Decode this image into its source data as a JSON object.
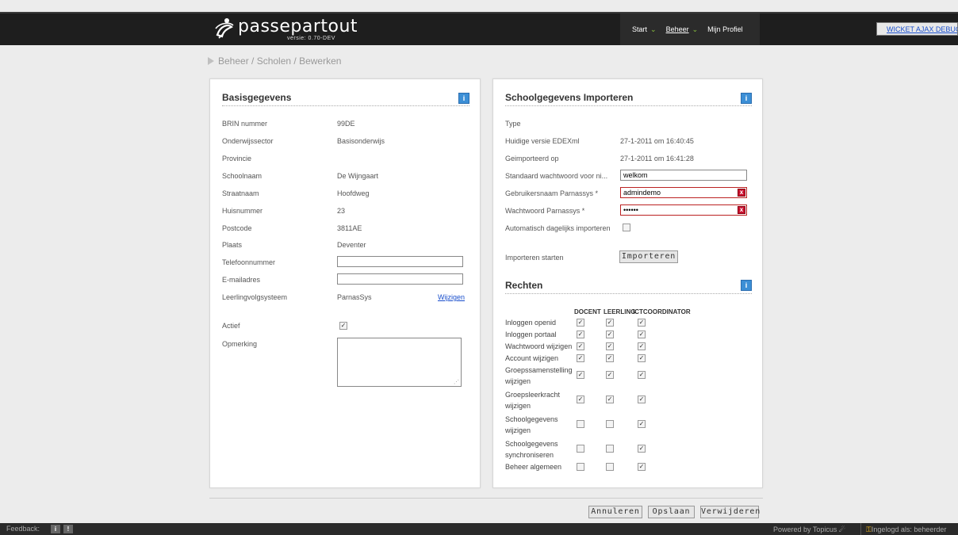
{
  "header": {
    "logo_text": "passepartout",
    "version": "versie: 0.70-DEV",
    "nav": [
      {
        "label": "Start",
        "has_dropdown": true
      },
      {
        "label": "Beheer",
        "has_dropdown": true,
        "active": true
      },
      {
        "label": "Mijn Profiel",
        "has_dropdown": false
      }
    ],
    "debug_link": "WICKET AJAX DEBUG"
  },
  "breadcrumb": "Beheer / Scholen / Bewerken",
  "basisgegevens": {
    "title": "Basisgegevens",
    "info": "i",
    "rows": [
      {
        "label": "BRIN nummer",
        "value": "99DE"
      },
      {
        "label": "Onderwijssector",
        "value": "Basisonderwijs"
      },
      {
        "label": "Provincie",
        "value": ""
      },
      {
        "label": "Schoolnaam",
        "value": "De Wijngaart"
      },
      {
        "label": "Straatnaam",
        "value": "Hoofdweg"
      },
      {
        "label": "Huisnummer",
        "value": "23"
      },
      {
        "label": "Postcode",
        "value": "3811AE"
      },
      {
        "label": "Plaats",
        "value": "Deventer"
      },
      {
        "label": "Telefoonnummer",
        "value": ""
      },
      {
        "label": "E-mailadres",
        "value": ""
      },
      {
        "label": "Leerlingvolgsysteem",
        "value": "ParnasSys"
      }
    ],
    "wijzigen_link": "Wijzigen",
    "actief_label": "Actief",
    "actief_checked": true,
    "opmerking_label": "Opmerking",
    "opmerking_value": ""
  },
  "import": {
    "title": "Schoolgegevens Importeren",
    "info": "i",
    "type_label": "Type",
    "type_value": "",
    "huidige_label": "Huidige versie EDEXml",
    "huidige_value": "27-1-2011 om 16:40:45",
    "geimporteerd_label": "Geimporteerd op",
    "geimporteerd_value": "27-1-2011 om 16:41:28",
    "standaard_label": "Standaard wachtwoord voor ni...",
    "standaard_value": "welkom",
    "gebruikersnaam_label": "Gebruikersnaam Parnassys *",
    "gebruikersnaam_value": "admindemo",
    "wachtwoord_label": "Wachtwoord Parnassys *",
    "wachtwoord_value": "••••••",
    "auto_label": "Automatisch dagelijks importeren",
    "auto_checked": false,
    "starten_label": "Importeren starten",
    "importeren_button": "Importeren",
    "error_icon": "x"
  },
  "rechten": {
    "title": "Rechten",
    "info": "i",
    "columns": [
      "DOCENT",
      "LEERLING",
      "ICTCOORDINATOR"
    ],
    "rows": [
      {
        "label": "Inloggen openid",
        "values": [
          true,
          true,
          true
        ]
      },
      {
        "label": "Inloggen portaal",
        "values": [
          true,
          true,
          true
        ]
      },
      {
        "label": "Wachtwoord wijzigen",
        "values": [
          true,
          true,
          true
        ]
      },
      {
        "label": "Account wijzigen",
        "values": [
          true,
          true,
          true
        ]
      },
      {
        "label": "Groepssamenstelling wijzigen",
        "values": [
          true,
          true,
          true
        ]
      },
      {
        "label": "Groepsleerkracht wijzigen",
        "values": [
          true,
          true,
          true
        ]
      },
      {
        "label": "Schoolgegevens wijzigen",
        "values": [
          false,
          false,
          true
        ]
      },
      {
        "label": "Schoolgegevens synchroniseren",
        "values": [
          false,
          false,
          true
        ]
      },
      {
        "label": "Beheer algemeen",
        "values": [
          false,
          false,
          true
        ]
      }
    ]
  },
  "actions": {
    "annuleren": "Annuleren",
    "opslaan": "Opslaan",
    "verwijderen": "Verwijderen"
  },
  "footer": {
    "feedback": "Feedback:",
    "feedback_info": "i",
    "feedback_alert": "!",
    "powered_by": "Powered by Topicus",
    "logged_in": "Ingelogd als: beheerder"
  }
}
